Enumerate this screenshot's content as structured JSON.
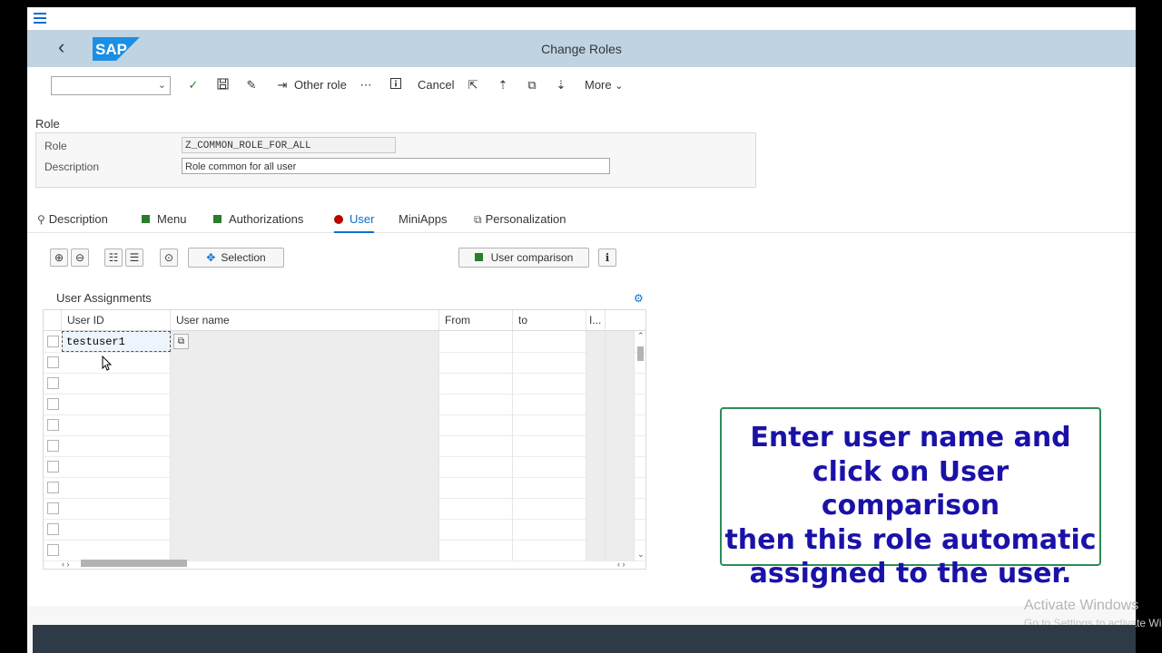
{
  "shell": {
    "title": "Change Roles",
    "logo_text": "SAP"
  },
  "toolbar": {
    "select_value": "",
    "other_role": "Other role",
    "cancel": "Cancel",
    "more": "More"
  },
  "role": {
    "section_title": "Role",
    "role_label": "Role",
    "role_value": "Z_COMMON_ROLE_FOR_ALL",
    "desc_label": "Description",
    "desc_value": "Role common for all user"
  },
  "tabs": [
    {
      "label": "Description"
    },
    {
      "label": "Menu"
    },
    {
      "label": "Authorizations"
    },
    {
      "label": "User"
    },
    {
      "label": "MiniApps"
    },
    {
      "label": "Personalization"
    }
  ],
  "user_tab": {
    "selection_label": "Selection",
    "user_comparison_label": "User comparison",
    "grid_title": "User Assignments",
    "columns": [
      "User ID",
      "User name",
      "From",
      "to",
      "I..."
    ],
    "rows": [
      {
        "user_id": "testuser1",
        "user_name": "",
        "from": "",
        "to": ""
      }
    ]
  },
  "callout": {
    "lines": [
      "Enter user name and",
      "click on User comparison",
      "then this role automatic",
      "assigned to the user."
    ]
  },
  "watermark": {
    "line1": "Activate Windows",
    "line2": "Go to Settings to activate Windows."
  },
  "colors": {
    "shellbar": "#c0d3e3",
    "accent": "#0a6ed1",
    "status_green": "#2b7d2b",
    "status_red": "#bb0000",
    "callout_border": "#2e8b57",
    "callout_text": "#1a12a8"
  }
}
